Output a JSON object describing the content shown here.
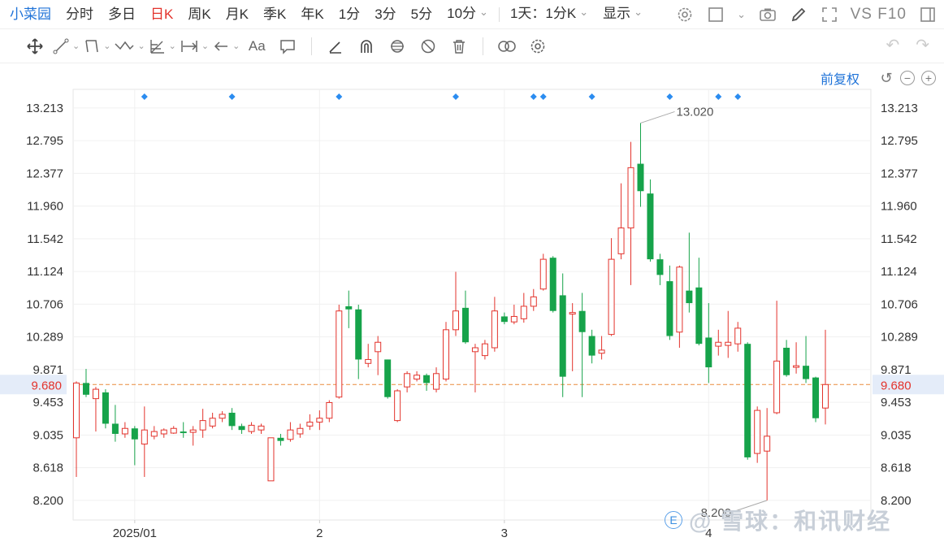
{
  "toolbar": {
    "brand": "小菜园",
    "tabs": [
      "分时",
      "多日",
      "日K",
      "周K",
      "月K",
      "季K",
      "年K",
      "1分",
      "3分",
      "5分"
    ],
    "active_tab": "日K",
    "more_periods": "10分",
    "interval": "1天：1分K",
    "display": "显示",
    "vs_f10": "VS F10"
  },
  "adjust": {
    "label": "前复权"
  },
  "chart_data": {
    "type": "candlestick",
    "up_color": "#e3332c",
    "down_color": "#16a34a",
    "ylim": [
      7.95,
      13.45
    ],
    "yticks": [
      "13.213",
      "12.795",
      "12.377",
      "11.960",
      "11.542",
      "11.124",
      "10.706",
      "10.289",
      "9.871",
      "9.453",
      "9.035",
      "8.618",
      "8.200"
    ],
    "xticks": [
      {
        "label": "2025/01",
        "index": 6
      },
      {
        "label": "2",
        "index": 25
      },
      {
        "label": "3",
        "index": 44
      },
      {
        "label": "4",
        "index": 65
      }
    ],
    "current_price": "9.680",
    "max_label": "13.020",
    "min_label": "8.200",
    "event_marker_indices": [
      7,
      16,
      27,
      39,
      47,
      48,
      53,
      61,
      66,
      68
    ],
    "candles": [
      [
        9.0,
        9.7,
        8.5,
        9.72
      ],
      [
        9.7,
        9.55,
        9.52,
        9.88
      ],
      [
        9.5,
        9.62,
        9.08,
        9.65
      ],
      [
        9.58,
        9.18,
        9.12,
        9.62
      ],
      [
        9.18,
        9.05,
        8.95,
        9.42
      ],
      [
        9.05,
        9.12,
        9.0,
        9.2
      ],
      [
        9.12,
        8.98,
        8.65,
        9.15
      ],
      [
        8.92,
        9.1,
        8.5,
        9.4
      ],
      [
        9.02,
        9.08,
        8.98,
        9.15
      ],
      [
        9.05,
        9.1,
        9.0,
        9.12
      ],
      [
        9.06,
        9.12,
        9.05,
        9.15
      ],
      [
        9.08,
        9.06,
        9.0,
        9.2
      ],
      [
        9.07,
        9.1,
        8.9,
        9.15
      ],
      [
        9.1,
        9.22,
        9.0,
        9.37
      ],
      [
        9.15,
        9.25,
        9.12,
        9.32
      ],
      [
        9.25,
        9.3,
        9.2,
        9.34
      ],
      [
        9.32,
        9.15,
        9.1,
        9.38
      ],
      [
        9.15,
        9.1,
        9.05,
        9.18
      ],
      [
        9.08,
        9.16,
        9.05,
        9.2
      ],
      [
        9.1,
        9.15,
        9.05,
        9.18
      ],
      [
        8.45,
        9.0,
        8.45,
        9.0
      ],
      [
        9.0,
        8.96,
        8.9,
        9.05
      ],
      [
        8.98,
        9.1,
        8.95,
        9.2
      ],
      [
        9.05,
        9.12,
        9.0,
        9.18
      ],
      [
        9.15,
        9.2,
        9.1,
        9.3
      ],
      [
        9.2,
        9.25,
        9.1,
        9.35
      ],
      [
        9.25,
        9.45,
        9.2,
        9.48
      ],
      [
        9.52,
        10.62,
        9.5,
        10.7
      ],
      [
        10.68,
        10.64,
        10.4,
        10.88
      ],
      [
        10.64,
        10.0,
        9.75,
        10.7
      ],
      [
        9.95,
        10.0,
        9.9,
        10.2
      ],
      [
        10.1,
        10.22,
        9.8,
        10.3
      ],
      [
        10.0,
        9.52,
        9.5,
        10.0
      ],
      [
        9.22,
        9.6,
        9.2,
        9.62
      ],
      [
        9.65,
        9.82,
        9.58,
        9.85
      ],
      [
        9.75,
        9.8,
        9.72,
        9.85
      ],
      [
        9.8,
        9.7,
        9.6,
        9.82
      ],
      [
        9.62,
        9.82,
        9.58,
        9.9
      ],
      [
        9.75,
        10.38,
        9.72,
        10.48
      ],
      [
        10.38,
        10.62,
        10.3,
        11.12
      ],
      [
        10.66,
        10.22,
        10.2,
        10.88
      ],
      [
        10.1,
        10.15,
        9.58,
        10.2
      ],
      [
        10.05,
        10.2,
        10.0,
        10.25
      ],
      [
        10.15,
        10.62,
        10.1,
        10.8
      ],
      [
        10.55,
        10.48,
        10.45,
        10.6
      ],
      [
        10.48,
        10.55,
        10.45,
        10.7
      ],
      [
        10.52,
        10.68,
        10.47,
        10.85
      ],
      [
        10.68,
        10.8,
        10.62,
        10.9
      ],
      [
        10.9,
        11.28,
        10.88,
        11.35
      ],
      [
        11.3,
        10.62,
        10.6,
        11.32
      ],
      [
        10.82,
        9.78,
        9.52,
        11.1
      ],
      [
        10.58,
        10.6,
        9.85,
        10.72
      ],
      [
        10.62,
        10.35,
        9.52,
        10.85
      ],
      [
        10.3,
        10.05,
        9.95,
        10.38
      ],
      [
        10.08,
        10.12,
        10.0,
        10.3
      ],
      [
        10.32,
        11.28,
        10.3,
        11.55
      ],
      [
        11.35,
        11.68,
        11.28,
        12.25
      ],
      [
        11.68,
        12.45,
        10.95,
        12.78
      ],
      [
        12.5,
        12.15,
        11.95,
        13.02
      ],
      [
        12.12,
        11.28,
        11.25,
        12.3
      ],
      [
        11.28,
        11.08,
        10.95,
        11.35
      ],
      [
        11.0,
        10.3,
        10.25,
        11.2
      ],
      [
        10.35,
        11.18,
        10.15,
        11.2
      ],
      [
        10.88,
        10.72,
        10.6,
        11.62
      ],
      [
        10.92,
        10.2,
        10.18,
        11.3
      ],
      [
        10.28,
        9.9,
        9.7,
        10.72
      ],
      [
        10.17,
        10.22,
        10.05,
        10.38
      ],
      [
        10.18,
        10.22,
        10.02,
        10.62
      ],
      [
        10.2,
        10.4,
        10.1,
        10.48
      ],
      [
        10.2,
        8.75,
        8.72,
        10.22
      ],
      [
        8.8,
        9.35,
        8.68,
        9.4
      ],
      [
        8.83,
        9.02,
        8.2,
        9.38
      ],
      [
        9.32,
        9.98,
        9.3,
        10.75
      ],
      [
        10.15,
        9.8,
        9.78,
        10.25
      ],
      [
        9.9,
        9.92,
        9.82,
        10.22
      ],
      [
        9.92,
        9.75,
        9.7,
        10.3
      ],
      [
        9.77,
        9.25,
        9.2,
        9.78
      ],
      [
        9.38,
        9.68,
        9.17,
        10.38
      ]
    ]
  }
}
